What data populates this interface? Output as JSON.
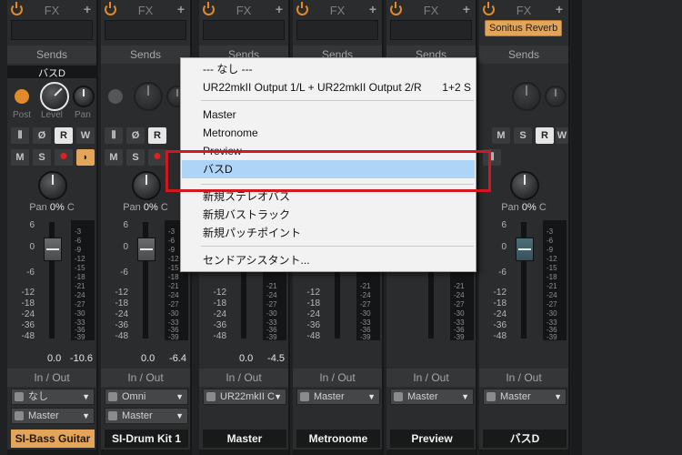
{
  "channels": [
    {
      "fx_label": "FX",
      "sends_label": "Sends",
      "send_dest": "バスD",
      "post_label": "Post",
      "level_label": "Level",
      "pan_knob_label": "Pan",
      "pan_label": "Pan",
      "pan_value": "0%",
      "pan_side": "C",
      "fader_value": "0.0",
      "peak_value": "-10.6",
      "io_label": "In / Out",
      "input": "なし",
      "output": "Master",
      "name": "SI-Bass Guitar",
      "highlight_name": true
    },
    {
      "fx_label": "FX",
      "sends_label": "Sends",
      "pan_label": "Pan",
      "pan_value": "0%",
      "pan_side": "C",
      "fader_value": "0.0",
      "peak_value": "-6.4",
      "io_label": "In / Out",
      "input": "Omni",
      "output": "Master",
      "name": "SI-Drum Kit 1"
    },
    {
      "fx_label": "FX",
      "sends_label": "Sends",
      "fader_value": "0.0",
      "peak_value": "-4.5",
      "io_label": "In / Out",
      "input": "UR22mkII C",
      "output": "",
      "name": "Master"
    },
    {
      "fx_label": "FX",
      "sends_label": "Sends",
      "io_label": "In / Out",
      "input": "Master",
      "output": "",
      "name": "Metronome"
    },
    {
      "fx_label": "FX",
      "sends_label": "Sends",
      "io_label": "In / Out",
      "input": "Master",
      "output": "",
      "name": "Preview"
    },
    {
      "fx_label": "FX",
      "plugin": "Sonitus Reverb",
      "sends_label": "Sends",
      "pan_label": "Pan",
      "pan_value": "0%",
      "pan_side": "C",
      "io_label": "In / Out",
      "input": "Master",
      "output": "",
      "name": "バスD"
    }
  ],
  "buttons": {
    "m": "M",
    "s": "S",
    "r": "R",
    "w": "W",
    "phase": "Ø"
  },
  "scale_ticks": [
    "6",
    "0",
    "-6",
    "-12",
    "-18",
    "-24",
    "-36",
    "-48"
  ],
  "meter_ticks": [
    "-3",
    "-6",
    "-9",
    "-12",
    "-15",
    "-18",
    "-21",
    "-24",
    "-27",
    "-30",
    "-33",
    "-36",
    "-39"
  ],
  "menu": {
    "items": [
      {
        "label": "--- なし ---"
      },
      {
        "label": "UR22mkII Output 1/L + UR22mkII Output 2/R",
        "shortcut": "1+2 S"
      },
      {
        "label": "Master"
      },
      {
        "label": "Metronome"
      },
      {
        "label": "Preview"
      },
      {
        "label": "バスD",
        "selected": true
      },
      {
        "label": "新規ステレオバス"
      },
      {
        "label": "新規バストラック"
      },
      {
        "label": "新規パッチポイント"
      },
      {
        "label": "センドアシスタント..."
      }
    ]
  },
  "colors": {
    "accent": "#e3a55a",
    "highlight_box": "#d11820",
    "menu_selected": "#aed4f7"
  }
}
